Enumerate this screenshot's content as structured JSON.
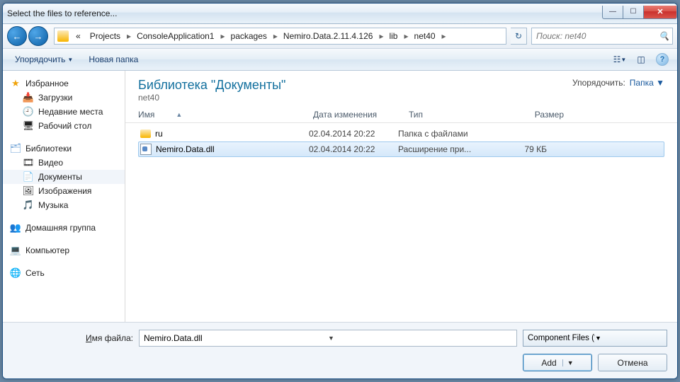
{
  "title": "Select the files to reference...",
  "breadcrumb": {
    "prefix": "«",
    "items": [
      "Projects",
      "ConsoleApplication1",
      "packages",
      "Nemiro.Data.2.11.4.126",
      "lib",
      "net40"
    ]
  },
  "search": {
    "placeholder": "Поиск: net40"
  },
  "toolbar": {
    "organize": "Упорядочить",
    "newfolder": "Новая папка"
  },
  "sidebar": {
    "favorites": {
      "label": "Избранное",
      "items": [
        "Загрузки",
        "Недавние места",
        "Рабочий стол"
      ]
    },
    "libraries": {
      "label": "Библиотеки",
      "items": [
        "Видео",
        "Документы",
        "Изображения",
        "Музыка"
      ]
    },
    "homegroup": "Домашняя группа",
    "computer": "Компьютер",
    "network": "Сеть"
  },
  "library": {
    "title": "Библиотека \"Документы\"",
    "sub": "net40",
    "arrange_label": "Упорядочить:",
    "arrange_value": "Папка"
  },
  "columns": {
    "name": "Имя",
    "date": "Дата изменения",
    "type": "Тип",
    "size": "Размер"
  },
  "rows": [
    {
      "name": "ru",
      "date": "02.04.2014 20:22",
      "type": "Папка с файлами",
      "size": "",
      "kind": "folder",
      "selected": false
    },
    {
      "name": "Nemiro.Data.dll",
      "date": "02.04.2014 20:22",
      "type": "Расширение при...",
      "size": "79 КБ",
      "kind": "dll",
      "selected": true
    }
  ],
  "filename": {
    "label_pre": "И",
    "label_rest": "мя файла:",
    "value": "Nemiro.Data.dll"
  },
  "filter": "Component Files (*.dll;*.tlb;*.ol",
  "buttons": {
    "add": "Add",
    "cancel": "Отмена"
  }
}
